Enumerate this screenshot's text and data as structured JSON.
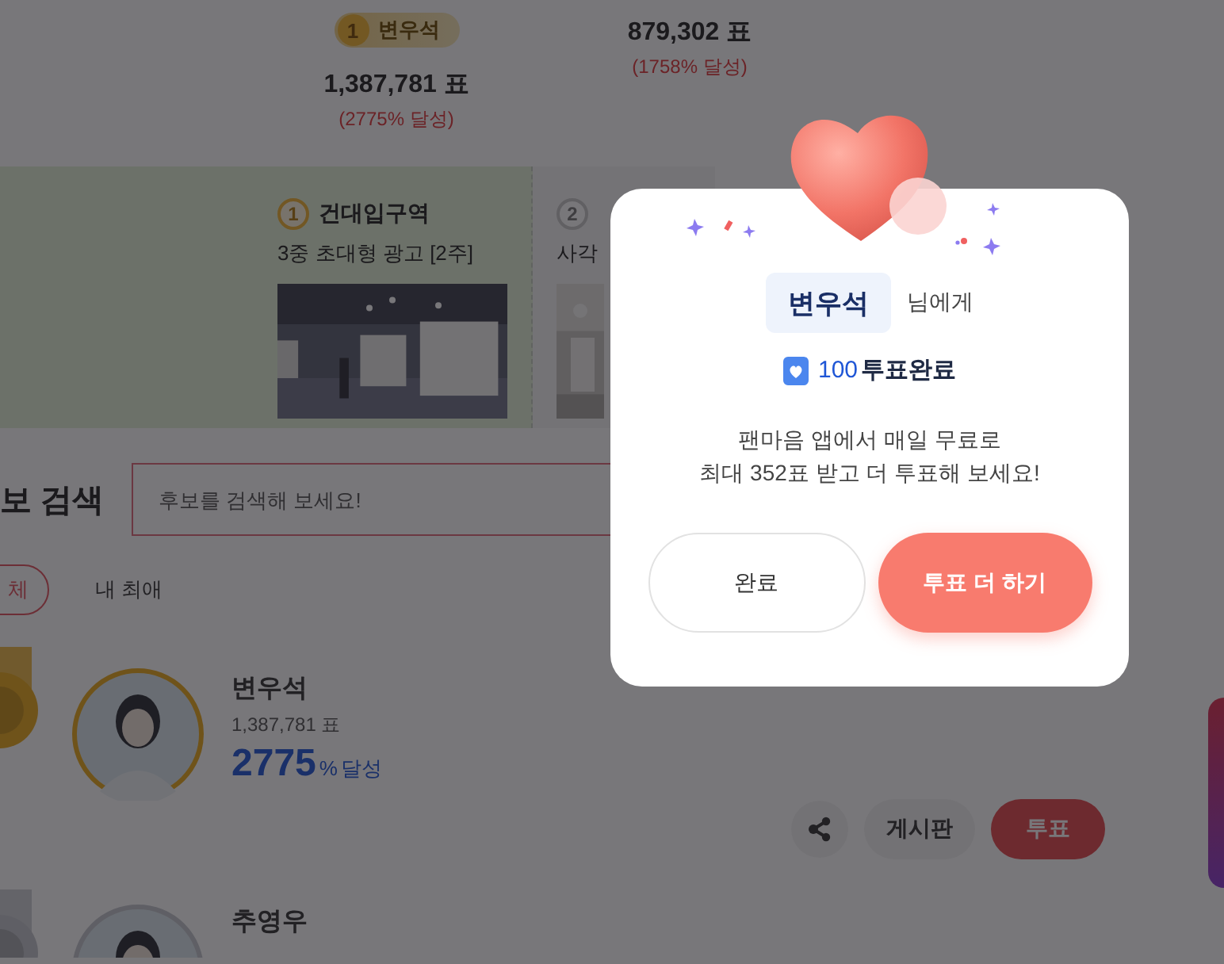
{
  "top_ranking": [
    {
      "rank": "1",
      "name": "변우석",
      "votes": "1,387,781 표",
      "achievement": "(2775% 달성)"
    },
    {
      "votes": "879,302 표",
      "achievement": "(1758% 달성)"
    }
  ],
  "ads": [
    {
      "rank": "1",
      "location": "건대입구역",
      "title": "3중 초대형 광고 [2주]"
    },
    {
      "rank": "2",
      "title": "사각"
    }
  ],
  "search": {
    "title": "보 검색",
    "placeholder": "후보를 검색해 보세요!"
  },
  "filters": [
    {
      "label": "체",
      "selected": true
    },
    {
      "label": "내 최애",
      "selected": false
    }
  ],
  "candidates": [
    {
      "name": "변우석",
      "votes": "1,387,781 표",
      "percent": "2775",
      "percent_suffix": "%",
      "achievement_label": "달성",
      "medal": {
        "color": "#6f531b"
      },
      "actions": [
        "게시판",
        "투표"
      ]
    },
    {
      "name": "추영우",
      "medal": {
        "color": "#5f5f65"
      }
    }
  ],
  "modal": {
    "recipient": "변우석",
    "recipient_suffix": "님에게",
    "vote_count": "100",
    "vote_label": "투표완료",
    "message": [
      "팬마음 앱에서 매일 무료로",
      "최대 352표 받고 더 투표해 보세요!"
    ],
    "buttons": [
      {
        "label": "완료",
        "kind": "secondary"
      },
      {
        "label": "투표 더 하기",
        "kind": "primary"
      }
    ]
  }
}
